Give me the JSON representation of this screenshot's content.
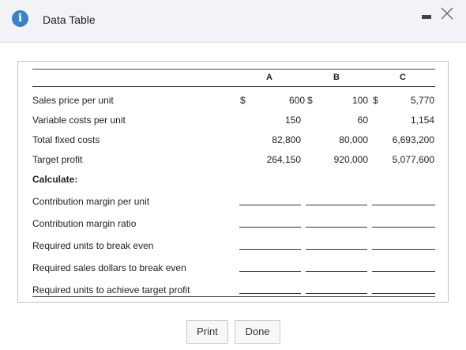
{
  "dialog": {
    "title": "Data Table",
    "icon": "info-icon"
  },
  "table": {
    "columns": [
      "A",
      "B",
      "C"
    ],
    "rows": [
      {
        "label": "Sales price per unit",
        "values": [
          "600",
          "100",
          "5,770"
        ],
        "dollar": true
      },
      {
        "label": "Variable costs per unit",
        "values": [
          "150",
          "60",
          "1,154"
        ],
        "dollar": false
      },
      {
        "label": "Total fixed costs",
        "values": [
          "82,800",
          "80,000",
          "6,693,200"
        ],
        "dollar": false
      },
      {
        "label": "Target profit",
        "values": [
          "264,150",
          "920,000",
          "5,077,600"
        ],
        "dollar": false
      }
    ],
    "calculate_label": "Calculate:",
    "dollar_sign": "$",
    "calc_rows": [
      "Contribution margin per unit",
      "Contribution margin ratio",
      "Required units to break even",
      "Required sales dollars to break even",
      "Required units to achieve target profit"
    ]
  },
  "buttons": {
    "print": "Print",
    "done": "Done"
  }
}
